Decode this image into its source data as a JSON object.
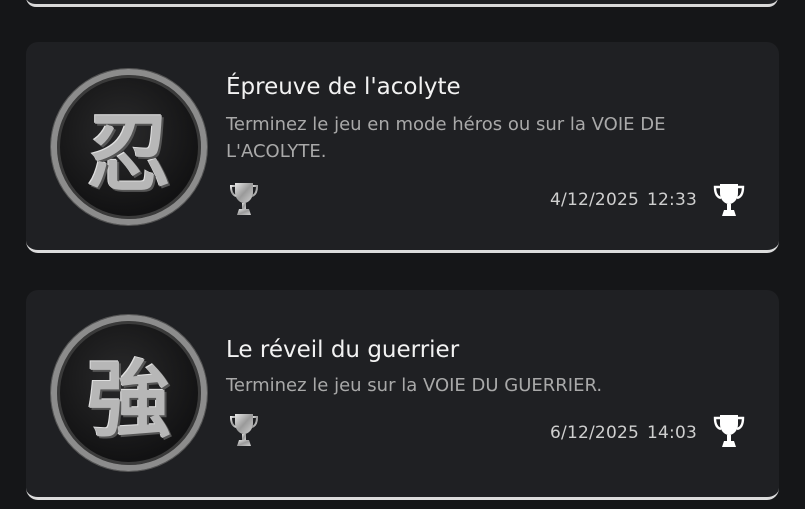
{
  "colors": {
    "background": "#151618",
    "card": "#1f2023",
    "card_accent_line": "#dcdcdc",
    "title_text": "#f2f2f2",
    "description_text": "#a9a9a9",
    "trophy_silver": "#bdbdbd",
    "trophy_white": "#ffffff"
  },
  "trophies": [
    {
      "emblem_glyph": "忍",
      "title": "Épreuve de l'acolyte",
      "description": "Terminez le jeu en mode héros ou sur la VOIE DE L'ACOLYTE.",
      "grade_icon": "silver-trophy-icon",
      "date": "4/12/2025",
      "time": "12:33",
      "status_icon": "trophy-earned-icon"
    },
    {
      "emblem_glyph": "強",
      "title": "Le réveil du guerrier",
      "description": "Terminez le jeu sur la VOIE DU GUERRIER.",
      "grade_icon": "silver-trophy-icon",
      "date": "6/12/2025",
      "time": "14:03",
      "status_icon": "trophy-earned-icon"
    }
  ]
}
